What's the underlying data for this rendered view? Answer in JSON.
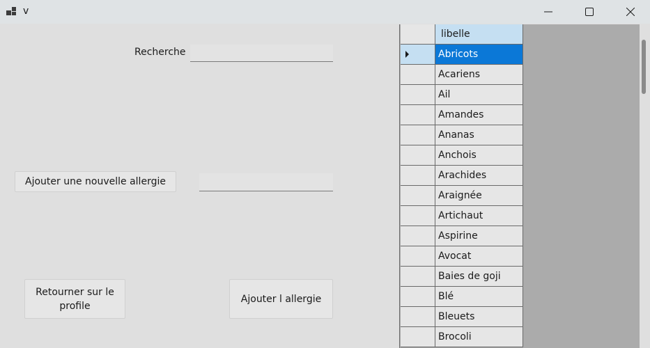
{
  "window": {
    "title": "v"
  },
  "search": {
    "label": "Recherche",
    "value": ""
  },
  "new_allergy": {
    "button_label": "Ajouter une nouvelle allergie",
    "value": ""
  },
  "actions": {
    "back_label": "Retourner sur le profile",
    "add_label": "Ajouter l allergie"
  },
  "grid": {
    "column_header": "libelle",
    "selected_index": 0,
    "rows": [
      "Abricots",
      "Acariens",
      "Ail",
      "Amandes",
      "Ananas",
      "Anchois",
      "Arachides",
      "Araignée",
      "Artichaut",
      "Aspirine",
      "Avocat",
      "Baies de goji",
      "Blé",
      "Bleuets",
      "Brocoli"
    ]
  },
  "colors": {
    "selection": "#0b78d7",
    "header": "#c5dff2",
    "grid_background": "#ababab"
  }
}
